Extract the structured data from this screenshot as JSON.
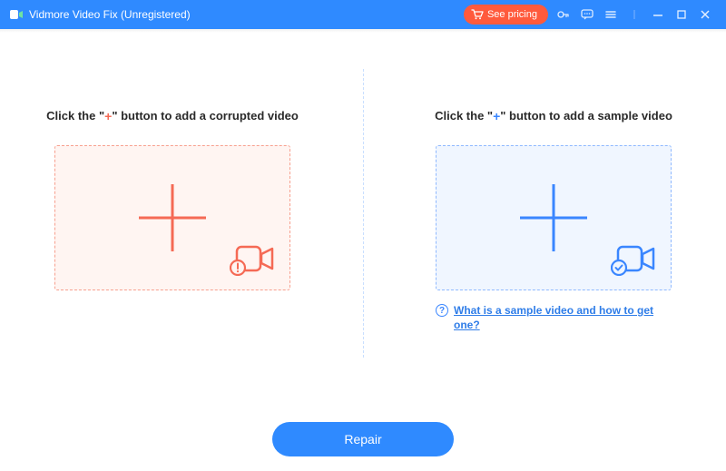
{
  "app": {
    "title": "Vidmore Video Fix (Unregistered)"
  },
  "titlebar": {
    "see_pricing_label": "See pricing"
  },
  "panels": {
    "corrupted": {
      "heading_before": "Click the \"",
      "heading_plus": "+",
      "heading_after": "\" button to add a corrupted video"
    },
    "sample": {
      "heading_before": "Click the \"",
      "heading_plus": "+",
      "heading_after": "\" button to add a sample video",
      "help_link": "What is a sample video and how to get one?",
      "help_symbol": "?"
    }
  },
  "footer": {
    "repair_label": "Repair"
  }
}
